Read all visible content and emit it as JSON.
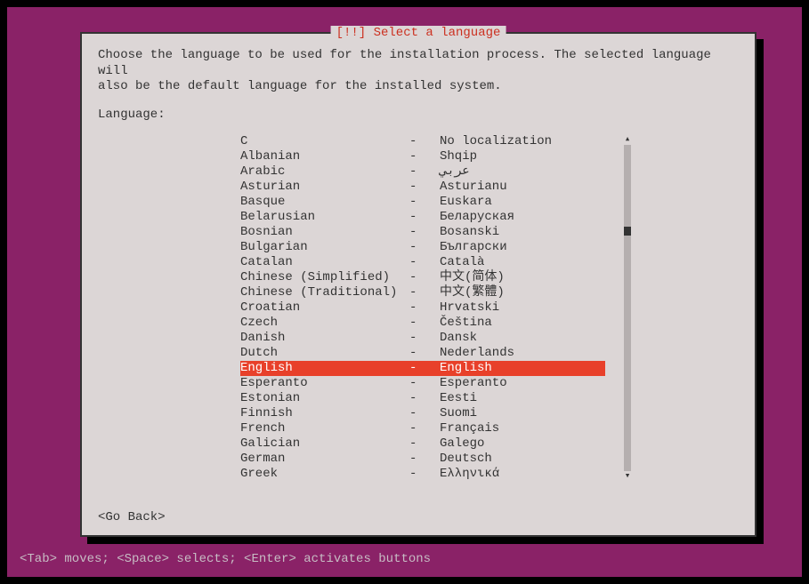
{
  "dialog": {
    "title": "[!!] Select a language",
    "description_line1": "Choose the language to be used for the installation process. The selected language will",
    "description_line2": "also be the default language for the installed system.",
    "field_label": "Language:",
    "go_back": "<Go Back>"
  },
  "languages": [
    {
      "name": "C",
      "native": "No localization",
      "selected": false
    },
    {
      "name": "Albanian",
      "native": "Shqip",
      "selected": false
    },
    {
      "name": "Arabic",
      "native": "عربي",
      "selected": false
    },
    {
      "name": "Asturian",
      "native": "Asturianu",
      "selected": false
    },
    {
      "name": "Basque",
      "native": "Euskara",
      "selected": false
    },
    {
      "name": "Belarusian",
      "native": "Беларуская",
      "selected": false
    },
    {
      "name": "Bosnian",
      "native": "Bosanski",
      "selected": false
    },
    {
      "name": "Bulgarian",
      "native": "Български",
      "selected": false
    },
    {
      "name": "Catalan",
      "native": "Català",
      "selected": false
    },
    {
      "name": "Chinese (Simplified)",
      "native": "中文(简体)",
      "selected": false
    },
    {
      "name": "Chinese (Traditional)",
      "native": "中文(繁體)",
      "selected": false
    },
    {
      "name": "Croatian",
      "native": "Hrvatski",
      "selected": false
    },
    {
      "name": "Czech",
      "native": "Čeština",
      "selected": false
    },
    {
      "name": "Danish",
      "native": "Dansk",
      "selected": false
    },
    {
      "name": "Dutch",
      "native": "Nederlands",
      "selected": false
    },
    {
      "name": "English",
      "native": "English",
      "selected": true
    },
    {
      "name": "Esperanto",
      "native": "Esperanto",
      "selected": false
    },
    {
      "name": "Estonian",
      "native": "Eesti",
      "selected": false
    },
    {
      "name": "Finnish",
      "native": "Suomi",
      "selected": false
    },
    {
      "name": "French",
      "native": "Français",
      "selected": false
    },
    {
      "name": "Galician",
      "native": "Galego",
      "selected": false
    },
    {
      "name": "German",
      "native": "Deutsch",
      "selected": false
    },
    {
      "name": "Greek",
      "native": "Ελληνικά",
      "selected": false
    }
  ],
  "separator": "-",
  "help_line": "<Tab> moves; <Space> selects; <Enter> activates buttons",
  "scroll": {
    "up": "▴",
    "down": "▾"
  },
  "colors": {
    "accent": "#8a2267",
    "highlight": "#e8402a",
    "panel": "#dcd6d6",
    "text": "#333"
  }
}
